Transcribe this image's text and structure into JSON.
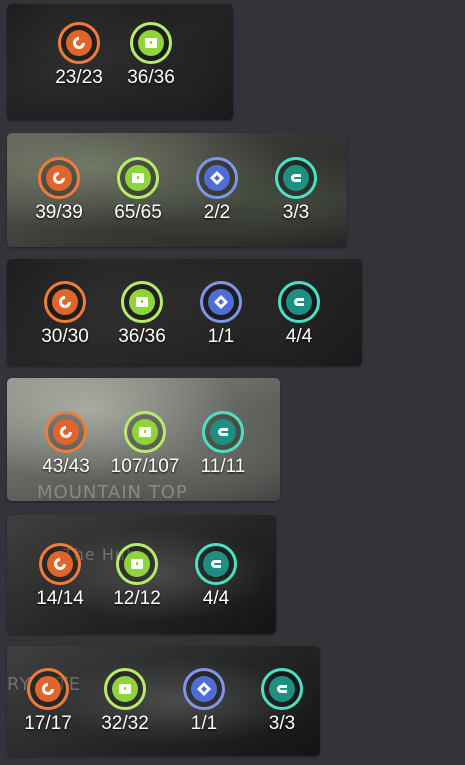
{
  "colors": {
    "orange": "#f07c3c",
    "green": "#b7ec6a",
    "blue": "#7f95ea",
    "cyan": "#4be0c6",
    "page_background": "#33343a"
  },
  "icons": {
    "orange": "coin-swirl-icon",
    "green": "chest-icon",
    "blue": "diamond-cube-icon",
    "cyan": "magnet-icon"
  },
  "cards": [
    {
      "resources": [
        {
          "type": "orange",
          "count": "23/23"
        },
        {
          "type": "green",
          "count": "36/36"
        }
      ]
    },
    {
      "resources": [
        {
          "type": "orange",
          "count": "39/39"
        },
        {
          "type": "green",
          "count": "65/65"
        },
        {
          "type": "blue",
          "count": "2/2"
        },
        {
          "type": "cyan",
          "count": "3/3"
        }
      ]
    },
    {
      "resources": [
        {
          "type": "orange",
          "count": "30/30"
        },
        {
          "type": "green",
          "count": "36/36"
        },
        {
          "type": "blue",
          "count": "1/1"
        },
        {
          "type": "cyan",
          "count": "4/4"
        }
      ]
    },
    {
      "map_label": "MOUNTAIN TOP",
      "resources": [
        {
          "type": "orange",
          "count": "43/43"
        },
        {
          "type": "green",
          "count": "107/107"
        },
        {
          "type": "cyan",
          "count": "11/11"
        }
      ]
    },
    {
      "map_label": "The Hub",
      "resources": [
        {
          "type": "orange",
          "count": "14/14"
        },
        {
          "type": "green",
          "count": "12/12"
        },
        {
          "type": "cyan",
          "count": "4/4"
        }
      ]
    },
    {
      "map_label": "RY SITE",
      "resources": [
        {
          "type": "orange",
          "count": "17/17"
        },
        {
          "type": "green",
          "count": "32/32"
        },
        {
          "type": "blue",
          "count": "1/1"
        },
        {
          "type": "cyan",
          "count": "3/3"
        }
      ]
    }
  ]
}
